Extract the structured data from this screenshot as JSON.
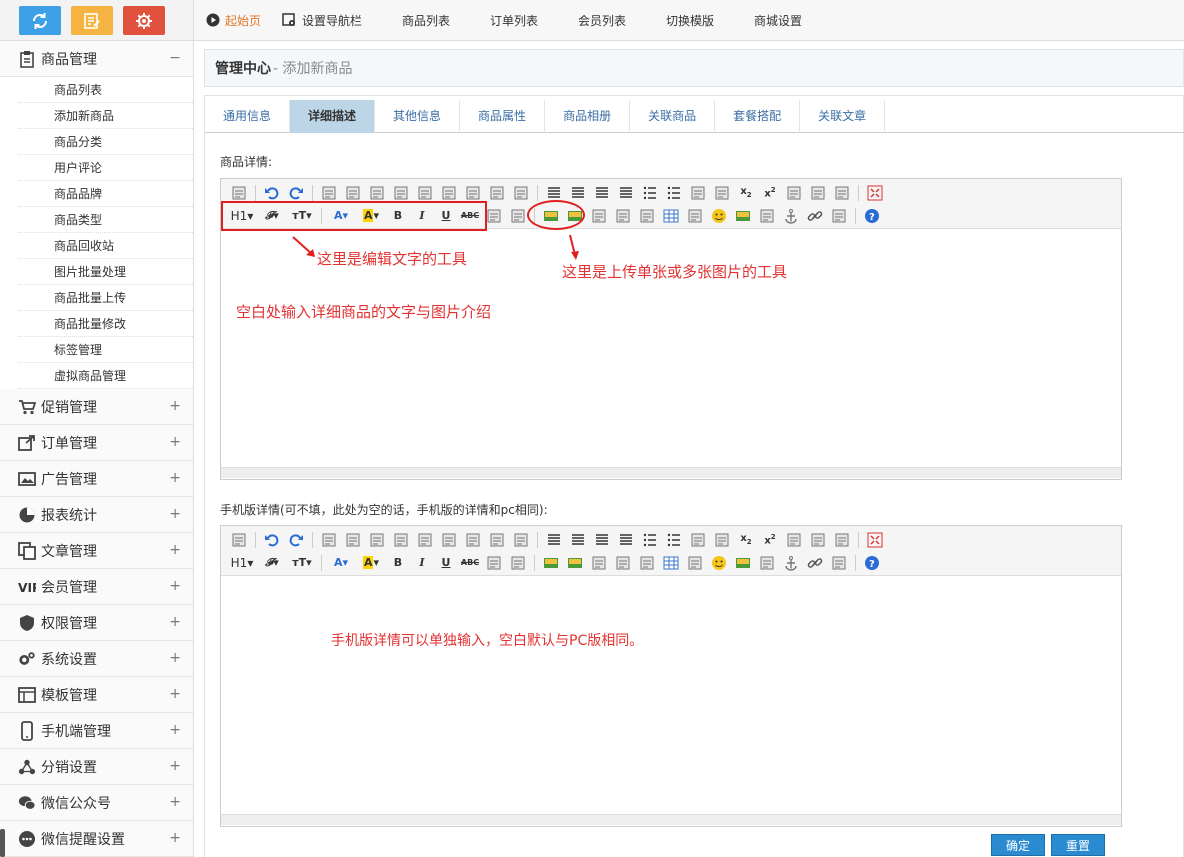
{
  "topnav": {
    "items": [
      {
        "label": "起始页",
        "icon": "play-circle-icon",
        "active": true
      },
      {
        "label": "设置导航栏",
        "icon": "settings-nav-icon"
      },
      {
        "label": "商品列表"
      },
      {
        "label": "订单列表"
      },
      {
        "label": "会员列表"
      },
      {
        "label": "切换模版"
      },
      {
        "label": "商城设置"
      }
    ]
  },
  "quick_buttons": [
    {
      "icon": "refresh-icon",
      "color": "#3ea0e6"
    },
    {
      "icon": "edit-note-icon",
      "color": "#f5b342"
    },
    {
      "icon": "gear-icon",
      "color": "#e0523d"
    }
  ],
  "sidebar": {
    "goods": {
      "title": "商品管理",
      "toggle": "−",
      "items": [
        "商品列表",
        "添加新商品",
        "商品分类",
        "用户评论",
        "商品品牌",
        "商品类型",
        "商品回收站",
        "图片批量处理",
        "商品批量上传",
        "商品批量修改",
        "标签管理",
        "虚拟商品管理"
      ]
    },
    "groups": [
      {
        "title": "促销管理",
        "icon": "cart-icon"
      },
      {
        "title": "订单管理",
        "icon": "share-icon"
      },
      {
        "title": "广告管理",
        "icon": "image-icon"
      },
      {
        "title": "报表统计",
        "icon": "pie-chart-icon"
      },
      {
        "title": "文章管理",
        "icon": "copy-icon"
      },
      {
        "title": "会员管理",
        "icon": "vip-icon"
      },
      {
        "title": "权限管理",
        "icon": "shield-icon"
      },
      {
        "title": "系统设置",
        "icon": "gears-icon"
      },
      {
        "title": "模板管理",
        "icon": "template-icon"
      },
      {
        "title": "手机端管理",
        "icon": "mobile-icon"
      },
      {
        "title": "分销设置",
        "icon": "network-icon"
      },
      {
        "title": "微信公众号",
        "icon": "wechat-icon"
      },
      {
        "title": "微信提醒设置",
        "icon": "chat-bubble-icon"
      }
    ],
    "plus": "+"
  },
  "breadcrumb": {
    "root": "管理中心",
    "current": "- 添加新商品"
  },
  "tabs": [
    "通用信息",
    "详细描述",
    "其他信息",
    "商品属性",
    "商品相册",
    "关联商品",
    "套餐搭配",
    "关联文章"
  ],
  "active_tab": "详细描述",
  "form": {
    "detail_label": "商品详情:",
    "mobile_label": "手机版详情(可不填，此处为空的话，手机版的详情和pc相同):"
  },
  "annotations": {
    "text_tools": "这里是编辑文字的工具",
    "image_tools": "这里是上传单张或多张图片的工具",
    "blank_hint": "空白处输入详细商品的文字与图片介绍",
    "mobile_hint": "手机版详情可以单独输入，空白默认与PC版相同。"
  },
  "buttons": {
    "confirm": "确定",
    "reset": "重置"
  },
  "colors": {
    "annotation": "#e23232",
    "primary_button": "#2b8bd0",
    "active_tab": "#bcd6e7",
    "tab_link": "#3a6ea5",
    "nav_active": "#e4762a"
  }
}
